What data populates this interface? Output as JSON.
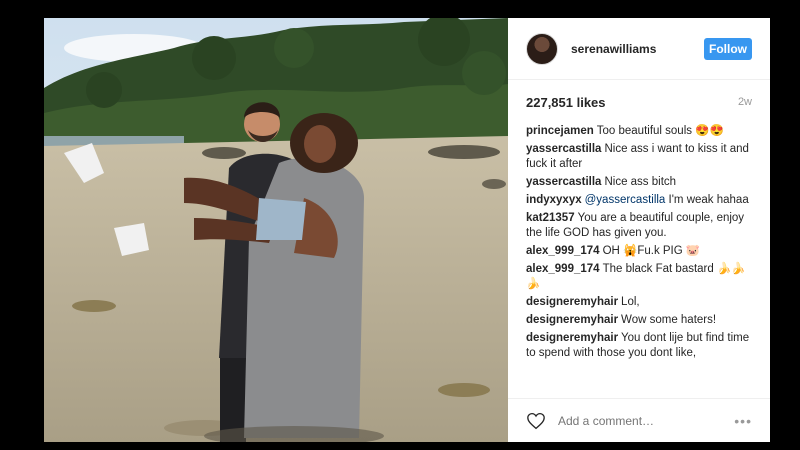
{
  "post": {
    "image_alt": "Couple on a sandy beach with trees in the background",
    "username": "serenawilliams",
    "follow_label": "Follow",
    "likes": "227,851 likes",
    "time": "2w",
    "add_comment_placeholder": "Add a comment…"
  },
  "comments": [
    {
      "author": "princejamen",
      "text": "Too beautiful souls 😍😍"
    },
    {
      "author": "yassercastilla",
      "text": "Nice ass i want to kiss it and fuck it after"
    },
    {
      "author": "yassercastilla",
      "text": "Nice ass bitch"
    },
    {
      "author": "indyxyxyx",
      "mention": "@yassercastilla",
      "text": " I'm weak hahaa"
    },
    {
      "author": "kat21357",
      "text": "You are a beautiful couple, enjoy the life GOD has given you."
    },
    {
      "author": "alex_999_174",
      "text": "OH 🙀Fu.k PIG 🐷"
    },
    {
      "author": "alex_999_174",
      "text": "The black Fat bastard 🍌🍌🍌"
    },
    {
      "author": "designeremyhair",
      "text": "Lol,"
    },
    {
      "author": "designeremyhair",
      "text": "Wow some haters!"
    },
    {
      "author": "designeremyhair",
      "text": "You dont lije but find time to spend with those you dont like,"
    }
  ],
  "colors": {
    "follow": "#3897f0",
    "text": "#262626",
    "muted": "#999999",
    "background": "#000000"
  },
  "icons": {
    "like": "heart-icon",
    "more": "more-options-icon"
  }
}
